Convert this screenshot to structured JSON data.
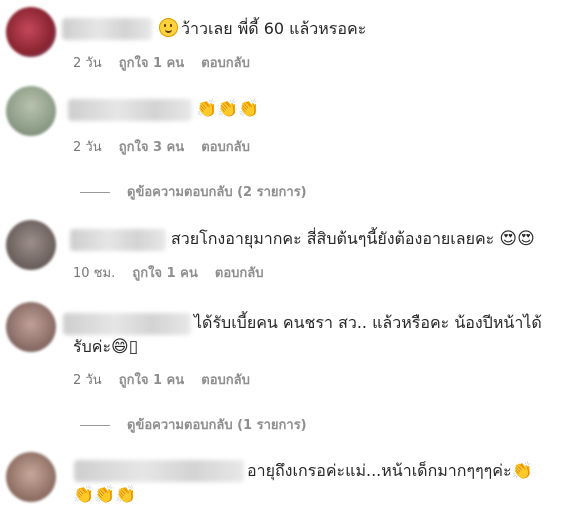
{
  "comments": [
    {
      "text": "ว้าวเลย พี่ดี้ 60 แล้วหรอคะ",
      "emoji_before": "🙂",
      "time": "2 วัน",
      "likes": "ถูกใจ 1 คน",
      "reply": "ตอบกลับ",
      "avatar_color": "#b0303a"
    },
    {
      "text": "",
      "emoji_after": "👏👏👏",
      "time": "2 วัน",
      "likes": "ถูกใจ 3 คน",
      "reply": "ตอบกลับ",
      "view_replies": "ดูข้อความตอบกลับ (2 รายการ)",
      "avatar_color": "#8fa08a"
    },
    {
      "text": "สวยโกงอายุมากคะ สี่สิบต้นๆนี้ยังต้องอายเลยคะ",
      "emoji_after": "😍😍",
      "time": "10 ชม.",
      "likes": "ถูกใจ 1 คน",
      "reply": "ตอบกลับ",
      "avatar_color": "#7a6e6c"
    },
    {
      "text": "ได้รับเบี้ยคน คนชรา สว.. แล้วหรือคะ น้องปีหน้าได้",
      "text_line2": "รับค่ะ",
      "emoji_after": "😄▯",
      "time": "2 วัน",
      "likes": "ถูกใจ 1 คน",
      "reply": "ตอบกลับ",
      "view_replies": "ดูข้อความตอบกลับ (1 รายการ)",
      "avatar_color": "#9b7a74"
    },
    {
      "text": "อายุถึงเกรอค่ะแม่...หน้าเด็กมากๆๆๆค่ะ",
      "emoji_after": "👏",
      "emoji_line2": "👏👏👏",
      "avatar_color": "#a08478"
    }
  ]
}
